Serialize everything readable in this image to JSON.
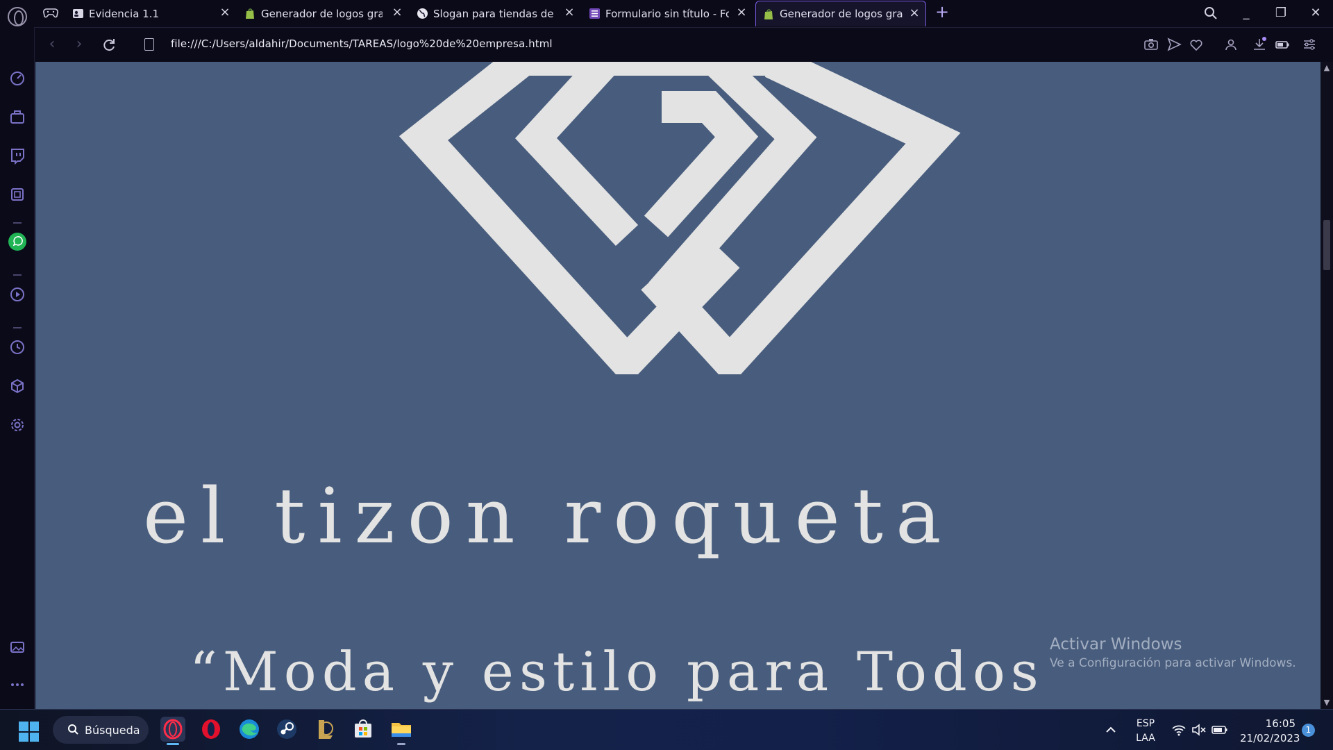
{
  "tabs": [
    {
      "title": "Evidencia 1.1",
      "favicon": "person-card-icon",
      "active": false
    },
    {
      "title": "Generador de logos gratuito",
      "favicon": "shopify-bag-icon",
      "active": false
    },
    {
      "title": "Slogan para tiendas de Ropa",
      "favicon": "globe-icon",
      "active": false
    },
    {
      "title": "Formulario sin título - Formularios",
      "favicon": "forms-list-icon",
      "active": false
    },
    {
      "title": "Generador de logos gratuito",
      "favicon": "shopify-bag-icon",
      "active": true
    }
  ],
  "address_bar": {
    "url": "file:///C:/Users/aldahir/Documents/TAREAS/logo%20de%20empresa.html"
  },
  "page": {
    "brand_name": "el tizon roqueta",
    "slogan": "“Moda y estilo para Todos",
    "logo_color": "#e3e3e3",
    "background_color": "#485d7d"
  },
  "watermark": {
    "title": "Activar Windows",
    "subtitle": "Ve a Configuración para activar Windows."
  },
  "taskbar": {
    "search_label": "Búsqueda",
    "language_line1": "ESP",
    "language_line2": "LAA",
    "time": "16:05",
    "date": "21/02/2023",
    "notification_count": "1",
    "apps": [
      "opera-gx-icon",
      "opera-icon",
      "edge-icon",
      "steam-icon",
      "league-of-legends-icon",
      "microsoft-store-icon",
      "file-explorer-icon"
    ]
  },
  "colors": {
    "accent": "#7b5be6",
    "sidebar_icon": "#7a72c7",
    "whatsapp": "#21b455"
  }
}
